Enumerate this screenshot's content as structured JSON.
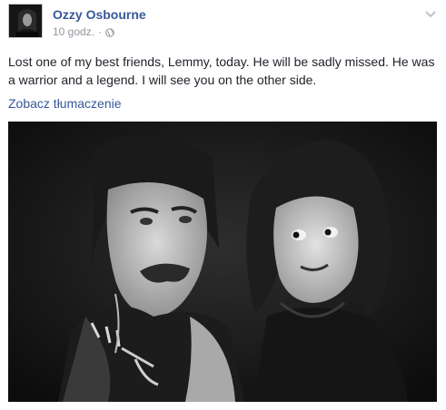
{
  "post": {
    "author": "Ozzy Osbourne",
    "timestamp": "10 godz.",
    "separator": "·",
    "audience_icon": "globe-icon",
    "menu_icon": "chevron-down-icon",
    "text": "Lost one of my best friends, Lemmy, today. He will be sadly missed. He was a warrior and a legend. I will see you on the other side.",
    "translate_link": "Zobacz tłumaczenie",
    "photo_description": "",
    "colors": {
      "link": "#365899",
      "meta": "#90949c",
      "text": "#1d2129"
    }
  }
}
